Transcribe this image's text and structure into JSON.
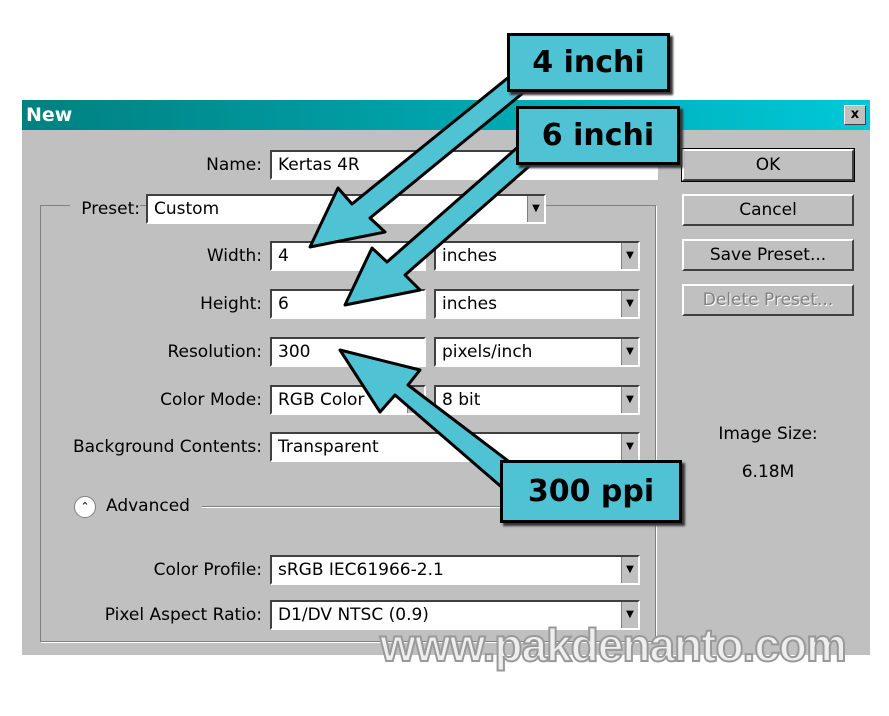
{
  "dialog": {
    "title": "New",
    "close": "x"
  },
  "form": {
    "name_label": "Name:",
    "name_value": "Kertas 4R",
    "preset_label": "Preset:",
    "preset_value": "Custom",
    "width_label": "Width:",
    "width_value": "4",
    "width_unit": "inches",
    "height_label": "Height:",
    "height_value": "6",
    "height_unit": "inches",
    "resolution_label": "Resolution:",
    "resolution_value": "300",
    "resolution_unit": "pixels/inch",
    "color_mode_label": "Color Mode:",
    "color_mode_value": "RGB Color",
    "bit_depth": "8 bit",
    "background_label": "Background Contents:",
    "background_value": "Transparent",
    "advanced_label": "Advanced",
    "color_profile_label": "Color Profile:",
    "color_profile_value": "sRGB IEC61966-2.1",
    "pixel_aspect_label": "Pixel Aspect Ratio:",
    "pixel_aspect_value": "D1/DV NTSC (0.9)"
  },
  "buttons": {
    "ok": "OK",
    "cancel": "Cancel",
    "save_preset": "Save Preset...",
    "delete_preset": "Delete Preset..."
  },
  "image_size": {
    "label": "Image Size:",
    "value": "6.18M"
  },
  "callouts": {
    "width": "4 inchi",
    "height": "6 inchi",
    "resolution": "300 ppi",
    "color": "#4fc3d3"
  },
  "watermark": "www.pakdenanto.com"
}
